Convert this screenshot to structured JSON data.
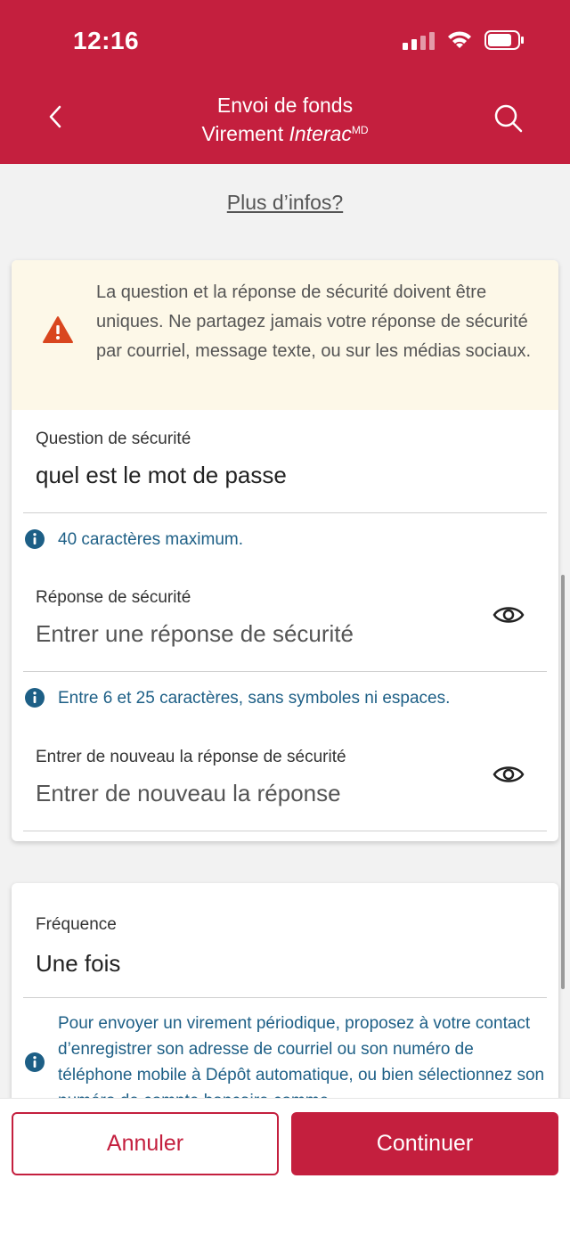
{
  "status_bar": {
    "time": "12:16"
  },
  "header": {
    "title_line1": "Envoi de fonds",
    "title_line2_prefix": "Virement ",
    "title_line2_brand": "Interac",
    "title_line2_mark": "MD"
  },
  "more_info": "Plus d’infos?",
  "security": {
    "warning": "La question et la réponse de sécurité doivent être uniques. Ne partagez jamais votre réponse de sécurité par courriel, message texte, ou sur les médias sociaux.",
    "question_label": "Question de sécurité",
    "question_value": "quel est le mot de passe",
    "question_hint": "40 caractères maximum.",
    "answer_label": "Réponse de sécurité",
    "answer_placeholder": "Entrer une réponse de sécurité",
    "answer_hint": "Entre 6 et 25 caractères, sans symboles ni espaces.",
    "confirm_label": "Entrer de nouveau la réponse de sécurité",
    "confirm_placeholder": "Entrer de nouveau la réponse"
  },
  "frequency": {
    "label": "Fréquence",
    "value": "Une fois",
    "hint": "Pour envoyer un virement périodique, proposez à votre contact d’enregistrer son adresse de courriel ou son numéro de téléphone mobile à Dépôt automatique, ou bien sélectionnez son numéro de compte bancaire comme"
  },
  "footer": {
    "cancel_label": "Annuler",
    "continue_label": "Continuer"
  },
  "colors": {
    "brand": "#c41f3e",
    "info": "#1d5f86",
    "warning_bg": "#fdf8e8",
    "warning_icon": "#d9461f"
  }
}
